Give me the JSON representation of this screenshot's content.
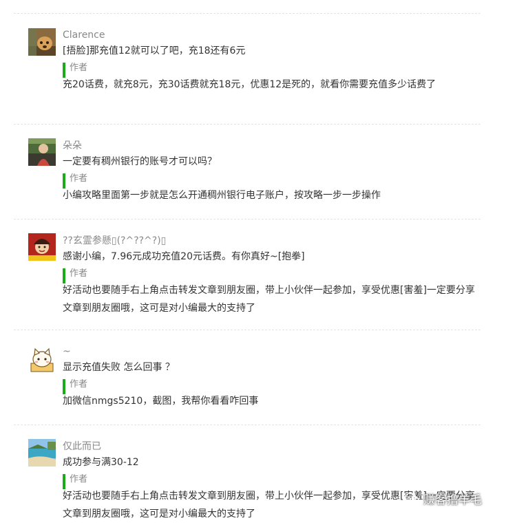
{
  "comments": [
    {
      "nickname": "Clarence",
      "avatar_icon": "dog-photo-avatar",
      "message": "[捂脸]那充值12就可以了吧，充18还有6元",
      "reply": {
        "author_label": "作者",
        "text": "充20话费，就充8元，充30话费就充18元，优惠12是死的，就看你需要充值多少话费了"
      }
    },
    {
      "nickname": "朵朵",
      "avatar_icon": "person-photo-avatar",
      "message": "一定要有稠州银行的账号才可以吗？",
      "reply": {
        "author_label": "作者",
        "text": "小编攻略里面第一步就是怎么开通稠州银行电子账户，按攻略一步一步操作"
      }
    },
    {
      "nickname": "??玄霊参懸▯(?^??^?)▯",
      "avatar_icon": "cartoon-character-avatar",
      "message": "感谢小编，7.96元成功充值20元话费。有你真好~[抱拳]",
      "reply": {
        "author_label": "作者",
        "text": "好活动也要随手右上角点击转发文章到朋友圈，带上小伙伴一起参加，享受优惠[害羞]一定要分享文章到朋友圈哦，这可是对小编最大的支持了"
      }
    },
    {
      "nickname": "~",
      "avatar_icon": "cat-in-box-avatar",
      "message": "显示充值失败 怎么回事 ？",
      "reply": {
        "author_label": "作者",
        "text": "加微信nmgs5210，截图，我帮你看看咋回事"
      }
    },
    {
      "nickname": "仅此而已",
      "avatar_icon": "beach-photo-avatar",
      "message": "成功参与满30-12",
      "reply": {
        "author_label": "作者",
        "text": "好活动也要随手右上角点击转发文章到朋友圈，带上小伙伴一起参加，享受优惠[害羞]一定要分享文章到朋友圈哦，这可是对小编最大的支持了"
      }
    }
  ],
  "watermark": {
    "icon": "wechat-icon",
    "text": "赚客撸羊毛"
  },
  "colors": {
    "author_bar": "#1aad19",
    "nickname": "#888888",
    "text": "#333333",
    "separator": "#e3e3e3"
  }
}
